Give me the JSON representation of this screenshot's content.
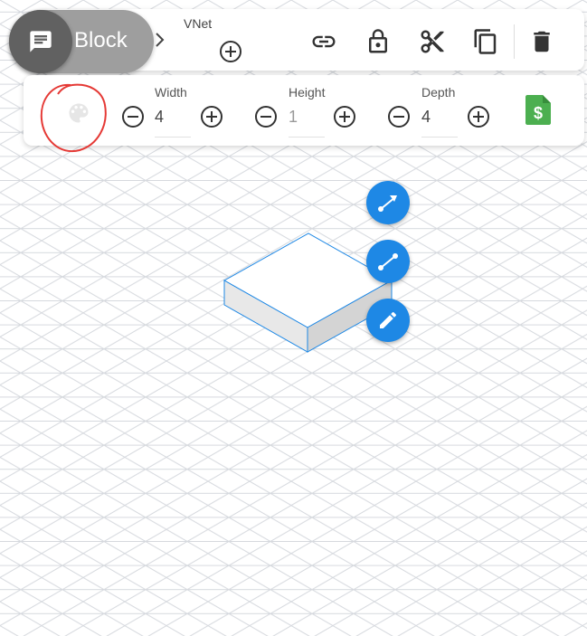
{
  "block": {
    "label": "Block",
    "avatar_icon": "comment-icon"
  },
  "vnet": {
    "label": "VNet",
    "add_icon": "add-circle-icon"
  },
  "toolbar": {
    "icons": [
      "link-icon",
      "lock-icon",
      "cut-icon",
      "copy-icon",
      "delete-icon"
    ]
  },
  "dimensions": {
    "width": {
      "label": "Width",
      "value": "4"
    },
    "height": {
      "label": "Height",
      "value": "1"
    },
    "depth": {
      "label": "Depth",
      "value": "4"
    }
  },
  "colors": {
    "accent": "#1e88e5",
    "cost_icon": "#4caf50",
    "annotation": "#e53935",
    "pill": "#9e9e9e",
    "avatar": "#616161"
  },
  "canvas_actions": [
    "connect-arrow-icon",
    "connect-line-icon",
    "edit-pencil-icon"
  ]
}
